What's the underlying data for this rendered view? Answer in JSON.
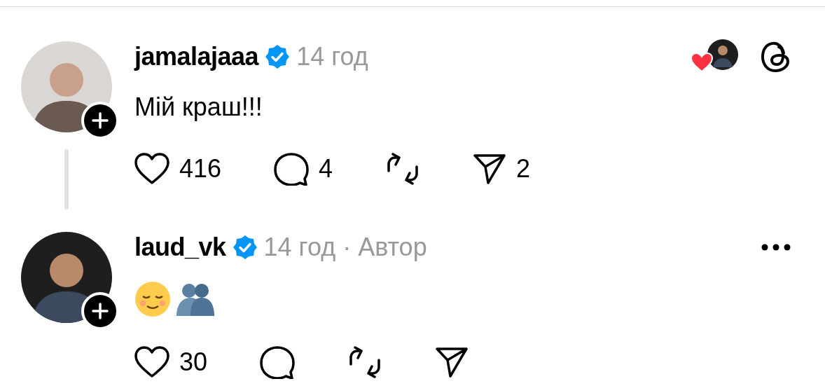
{
  "posts": [
    {
      "username": "jamalajaaa",
      "verified": true,
      "time": "14 год",
      "liked_by_author": true,
      "app_logo": true,
      "more_menu": false,
      "text": "Мій краш!!!",
      "thread_line": true,
      "actions": [
        {
          "kind": "like",
          "count": "416",
          "liked": false
        },
        {
          "kind": "reply",
          "count": "4"
        },
        {
          "kind": "repost"
        },
        {
          "kind": "share",
          "count": "2"
        }
      ]
    },
    {
      "username": "laud_vk",
      "verified": true,
      "time": "14 год",
      "author_tag": "· Автор",
      "liked_by_author": false,
      "app_logo": false,
      "more_menu": true,
      "emojis": [
        {
          "kind": "relieved"
        },
        {
          "kind": "hug"
        }
      ],
      "thread_line": false,
      "actions": [
        {
          "kind": "like",
          "count": "30",
          "liked": false
        },
        {
          "kind": "reply"
        },
        {
          "kind": "repost"
        },
        {
          "kind": "share"
        }
      ]
    }
  ]
}
